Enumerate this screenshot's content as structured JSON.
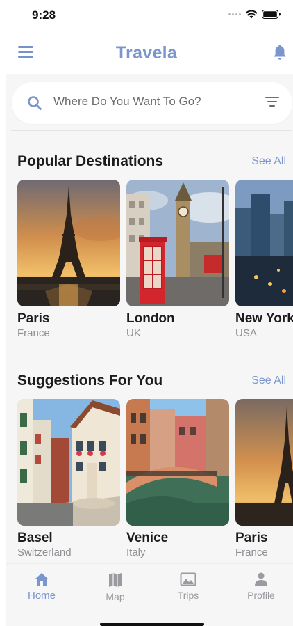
{
  "status_bar": {
    "time": "9:28"
  },
  "header": {
    "title": "Travela"
  },
  "search": {
    "placeholder": "Where Do You Want To Go?"
  },
  "sections": [
    {
      "title": "Popular Destinations",
      "see_all": "See All",
      "cards": [
        {
          "name": "Paris",
          "country": "France",
          "image": "eiffel-tower-sunset"
        },
        {
          "name": "London",
          "country": "UK",
          "image": "big-ben-phone-booth"
        },
        {
          "name": "New York",
          "country": "USA",
          "image": "city-skyline-night"
        }
      ]
    },
    {
      "title": "Suggestions For You",
      "see_all": "See All",
      "cards": [
        {
          "name": "Basel",
          "country": "Switzerland",
          "image": "old-town-houses"
        },
        {
          "name": "Venice",
          "country": "Italy",
          "image": "canal-bridge"
        },
        {
          "name": "Paris",
          "country": "France",
          "image": "eiffel-tower-sunset"
        }
      ]
    }
  ],
  "tabs": [
    {
      "label": "Home",
      "icon": "home-icon",
      "active": true
    },
    {
      "label": "Map",
      "icon": "map-icon",
      "active": false
    },
    {
      "label": "Trips",
      "icon": "image-icon",
      "active": false
    },
    {
      "label": "Profile",
      "icon": "person-icon",
      "active": false
    }
  ],
  "colors": {
    "accent": "#7a96cc",
    "background": "#f6f6f7",
    "inactive": "#9a9aa0"
  }
}
